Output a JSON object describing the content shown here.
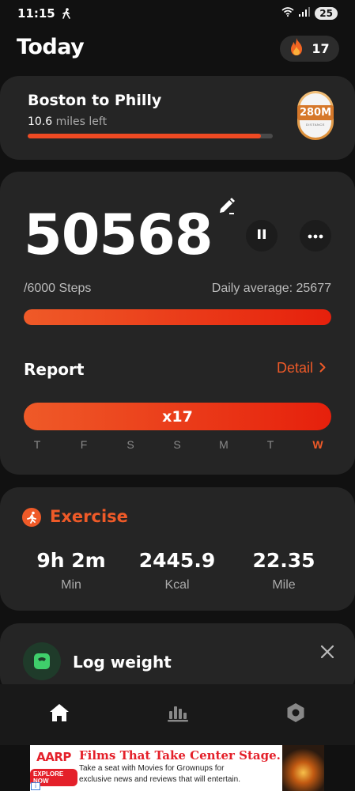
{
  "status_bar": {
    "time": "11:15",
    "battery": "25"
  },
  "header": {
    "title": "Today",
    "streak": "17"
  },
  "challenge": {
    "title": "Boston to Philly",
    "distance_left": "10.6",
    "distance_left_unit": "miles left",
    "progress_fraction": 0.95,
    "badge_value": "280M",
    "badge_sub": "DISTANCE"
  },
  "steps": {
    "count": "50568",
    "goal": "/6000 Steps",
    "daily_average": "Daily average: 25677",
    "progress_fraction": 1.0,
    "report_title": "Report",
    "detail_label": "Detail",
    "multiplier": "x17",
    "days": [
      "T",
      "F",
      "S",
      "S",
      "M",
      "T",
      "W"
    ],
    "today_index": 6
  },
  "exercise": {
    "title": "Exercise",
    "stats": [
      {
        "value": "9h 2m",
        "unit": "Min"
      },
      {
        "value": "2445.9",
        "unit": "Kcal"
      },
      {
        "value": "22.35",
        "unit": "Mile"
      }
    ]
  },
  "weight": {
    "title": "Log weight"
  },
  "nav": {
    "items": [
      "home-icon",
      "stats-icon",
      "settings-icon"
    ],
    "active_index": 0
  },
  "ad": {
    "brand": "AARP",
    "cta": "EXPLORE NOW",
    "headline": "Films That Take Center Stage.",
    "body_line1": "Take a seat with Movies for Grownups for",
    "body_line2": "exclusive news and reviews that will entertain.",
    "info": "i"
  },
  "colors": {
    "accent": "#ef5a28",
    "background": "#111111",
    "card": "#252525"
  }
}
